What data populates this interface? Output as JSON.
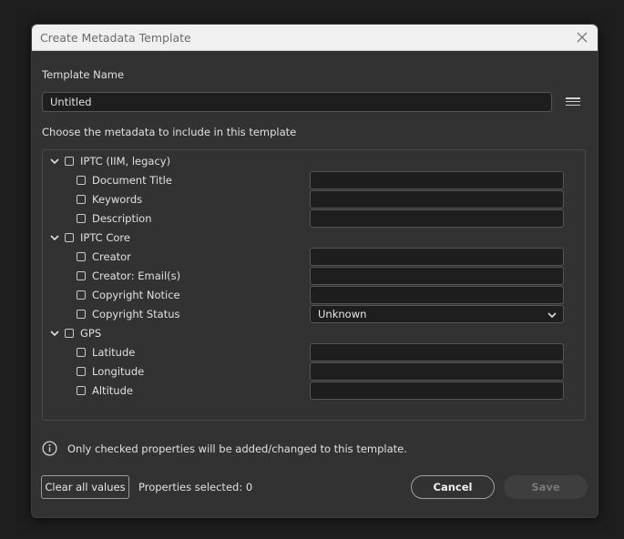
{
  "dialog": {
    "title": "Create Metadata Template",
    "template_name_label": "Template Name",
    "template_name_value": "Untitled",
    "choose_label": "Choose the metadata to include in this template",
    "info_text": "Only checked properties will be added/changed to this template.",
    "clear_button": "Clear all values",
    "properties_selected": "Properties selected: 0",
    "cancel_button": "Cancel",
    "save_button": "Save"
  },
  "groups": {
    "iptc_legacy": {
      "label": "IPTC (IIM, legacy)",
      "items": {
        "document_title": "Document Title",
        "keywords": "Keywords",
        "description": "Description"
      }
    },
    "iptc_core": {
      "label": "IPTC Core",
      "items": {
        "creator": "Creator",
        "creator_email": "Creator: Email(s)",
        "copyright_notice": "Copyright Notice",
        "copyright_status": "Copyright Status"
      },
      "copyright_status_value": "Unknown"
    },
    "gps": {
      "label": "GPS",
      "items": {
        "latitude": "Latitude",
        "longitude": "Longitude",
        "altitude": "Altitude"
      }
    }
  },
  "icons": {
    "close": "close-icon",
    "menu": "hamburger-menu-icon",
    "expand": "chevron-down-icon",
    "info": "info-icon"
  },
  "colors": {
    "background": "#323232",
    "titlebar": "#f0f0f0",
    "field_background": "#1e1e1e",
    "save_disabled": "#3e3e3e"
  }
}
